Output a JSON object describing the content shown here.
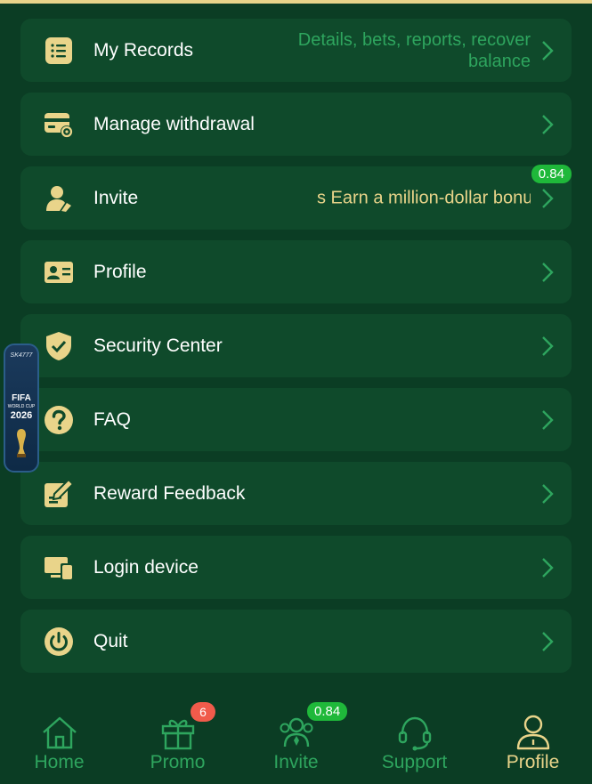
{
  "menu": {
    "items": [
      {
        "label": "My Records",
        "icon": "records-list-icon",
        "description": "Details, bets, reports, recover balance"
      },
      {
        "label": "Manage withdrawal",
        "icon": "withdrawal-card-icon"
      },
      {
        "label": "Invite",
        "icon": "invite-user-icon",
        "marquee": "s  Earn a million-dollar bonu",
        "badge": "0.84"
      },
      {
        "label": "Profile",
        "icon": "profile-card-icon"
      },
      {
        "label": "Security Center",
        "icon": "shield-check-icon"
      },
      {
        "label": "FAQ",
        "icon": "question-icon"
      },
      {
        "label": "Reward Feedback",
        "icon": "edit-note-icon"
      },
      {
        "label": "Login device",
        "icon": "devices-icon"
      },
      {
        "label": "Quit",
        "icon": "power-icon"
      }
    ]
  },
  "promo_banner": {
    "brand": "SK4777",
    "title": "FIFA",
    "subtitle": "WORLD CUP",
    "year": "2026"
  },
  "tabbar": {
    "tabs": [
      {
        "label": "Home",
        "icon": "home-icon"
      },
      {
        "label": "Promo",
        "icon": "gift-icon",
        "badge": "6"
      },
      {
        "label": "Invite",
        "icon": "invite-people-icon",
        "badge": "0.84"
      },
      {
        "label": "Support",
        "icon": "headset-icon"
      },
      {
        "label": "Profile",
        "icon": "user-icon",
        "active": true
      }
    ]
  },
  "colors": {
    "background": "#0b3d24",
    "card": "#0f4a2b",
    "accent": "#e9d48a",
    "green": "#2ea55e"
  }
}
